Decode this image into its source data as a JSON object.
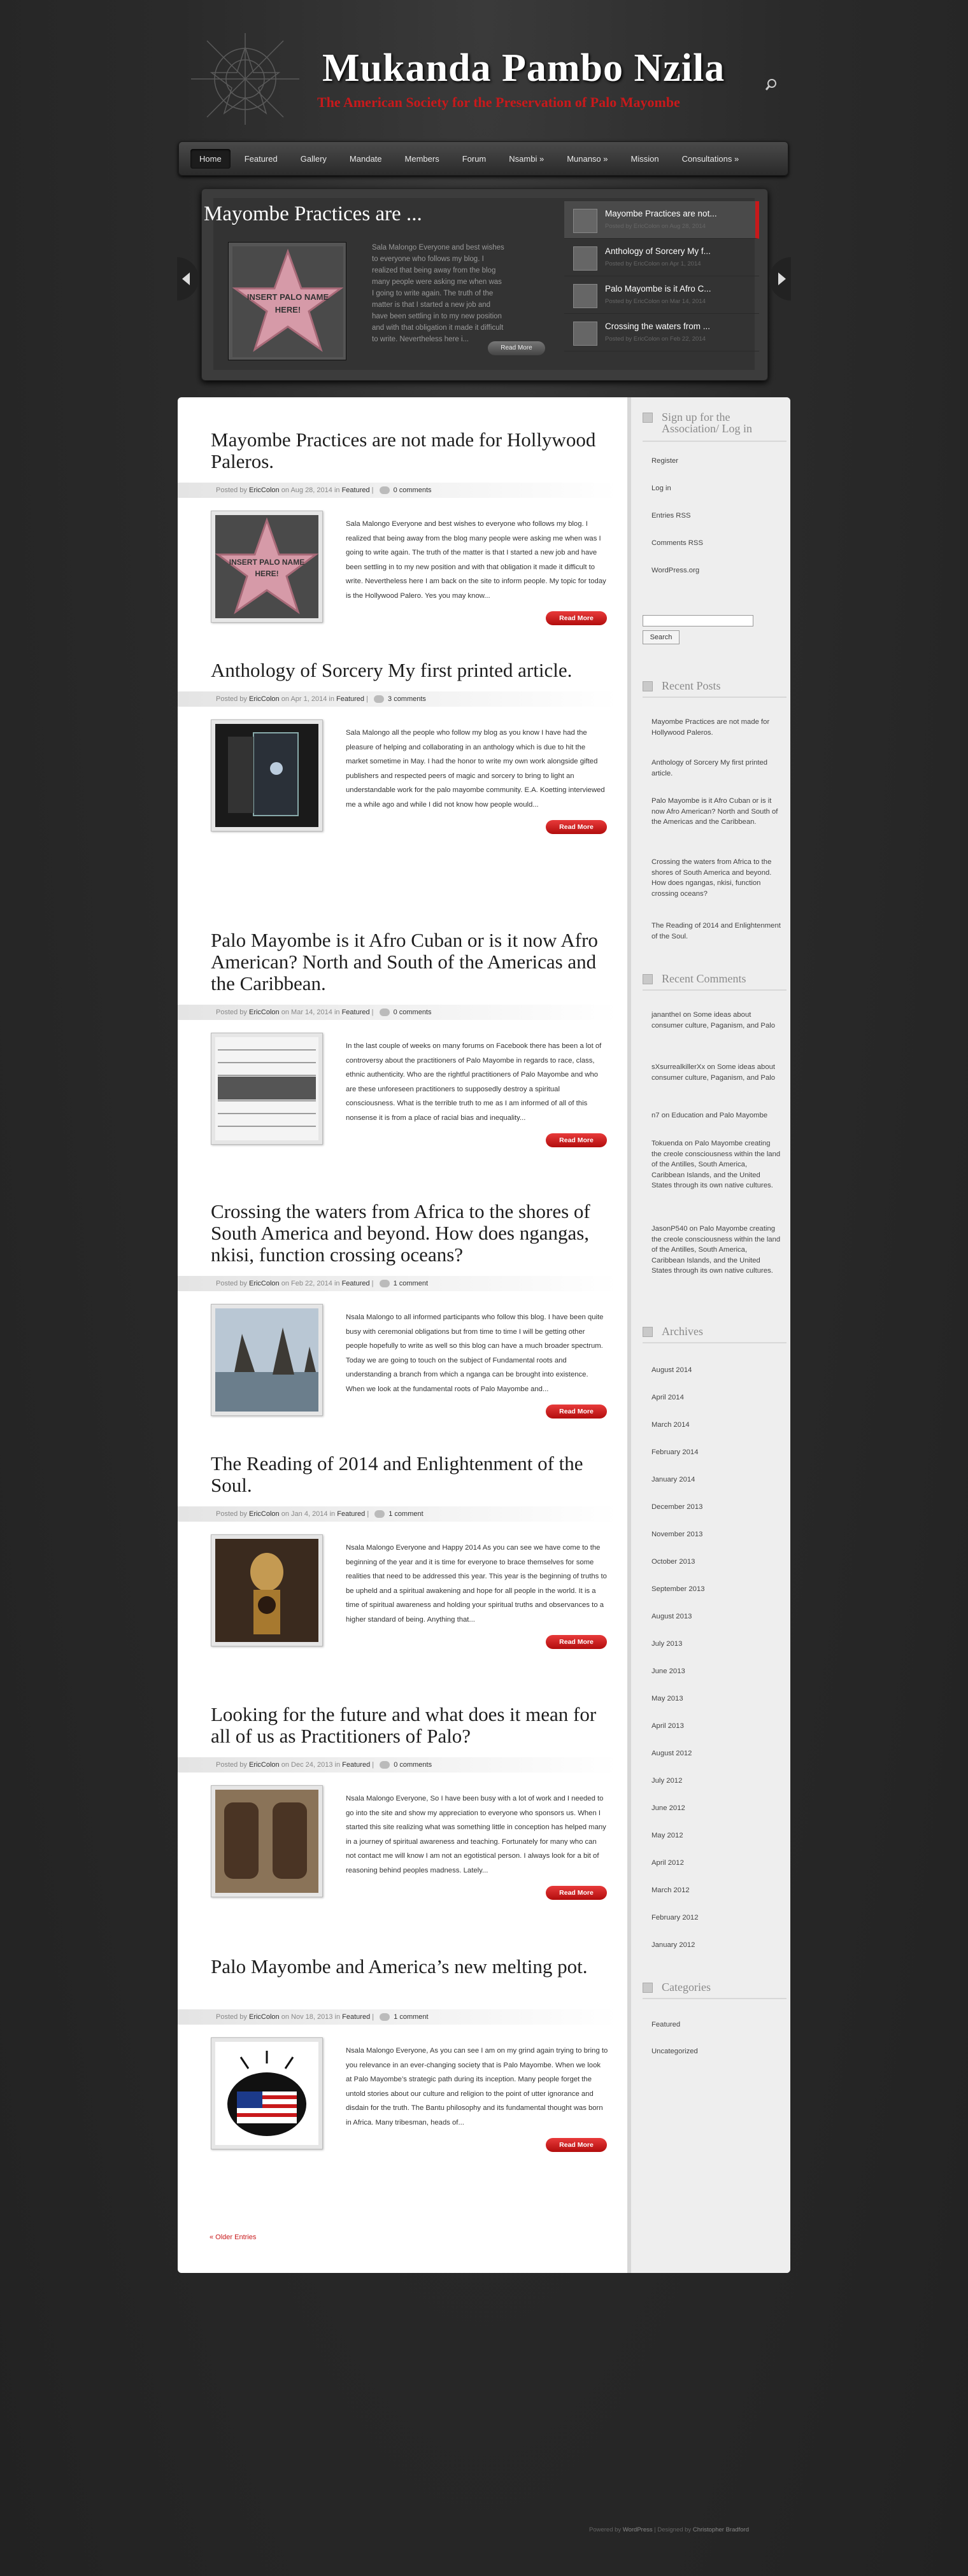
{
  "header": {
    "title": "Mukanda Pambo Nzila",
    "tagline": "The American Society for the Preservation of Palo Mayombe"
  },
  "nav": [
    "Home",
    "Featured",
    "Gallery",
    "Mandate",
    "Members",
    "Forum",
    "Nsambi »",
    "Munanso »",
    "Mission",
    "Consultations »"
  ],
  "slider": {
    "title": "Mayombe Practices are ...",
    "image_caption": "INSERT PALO NAME HERE!",
    "text": "Sala Malongo Everyone and best wishes to everyone who follows my blog. I realized that being away from the blog many people were asking me when was I going to write again. The truth of the matter is that I started a new job and have been settling in to my new position and with that obligation it made it difficult to write. Nevertheless here i...",
    "more": "Read More",
    "items": [
      {
        "title": "Mayombe Practices are not...",
        "meta": "Posted by EricColon on Aug 28, 2014"
      },
      {
        "title": "Anthology of Sorcery My f...",
        "meta": "Posted by EricColon on Apr 1, 2014"
      },
      {
        "title": "Palo Mayombe is it Afro C...",
        "meta": "Posted by EricColon on Mar 14, 2014"
      },
      {
        "title": "Crossing the waters from ...",
        "meta": "Posted by EricColon on Feb 22, 2014"
      }
    ]
  },
  "posts": [
    {
      "title": "Mayombe Practices are not made for Hollywood Paleros.",
      "author": "EricColon",
      "date": "Aug 28, 2014",
      "category": "Featured",
      "comments": "0 comments",
      "excerpt": "Sala Malongo Everyone and best wishes to everyone who follows my blog. I realized that being away from the blog many people were asking me when was I going to write again. The truth of the matter is that I started a new job and have been settling in to my new position and with that obligation it made it difficult to write. Nevertheless here I am back on the site to inform people. My topic for today is the Hollywood Palero. Yes you may know...",
      "more": "Read More"
    },
    {
      "title": "Anthology of Sorcery My first printed article.",
      "author": "EricColon",
      "date": "Apr 1, 2014",
      "category": "Featured",
      "comments": "3 comments",
      "excerpt": "Sala Malongo all the people who follow my blog as you know I have had the pleasure of helping and collaborating in an anthology which is due to hit the market sometime in May. I had the honor to write my own work alongside gifted publishers and respected peers of magic and sorcery to bring to light an understandable work for the palo mayombe community. E.A. Koetting interviewed me a while ago and while I did not know how people would...",
      "more": "Read More"
    },
    {
      "title": "Palo Mayombe is it Afro Cuban or is it now Afro American? North and South of the Americas and the Caribbean.",
      "author": "EricColon",
      "date": "Mar 14, 2014",
      "category": "Featured",
      "comments": "0 comments",
      "excerpt": "In the last couple of weeks on many forums on Facebook there has been a lot of controversy about the practitioners of Palo Mayombe in regards to race, class, ethnic authenticity. Who are the rightful practitioners of Palo Mayombe and who are these unforeseen practitioners to supposedly destroy a spiritual consciousness. What is the terrible truth to me as I am informed of all of this nonsense it is from a place of racial bias and inequality...",
      "more": "Read More"
    },
    {
      "title": "Crossing the waters from Africa to the shores of South America and beyond. How does ngangas, nkisi, function crossing oceans?",
      "author": "EricColon",
      "date": "Feb 22, 2014",
      "category": "Featured",
      "comments": "1 comment",
      "excerpt": "Nsala Malongo to all informed participants who follow this blog. I have been quite busy with ceremonial obligations but from time to time I will be getting other people hopefully to write as well so this blog can have a much broader spectrum. Today we are going to touch on the subject of Fundamental roots and understanding a branch from which a nganga can be brought into existence. When we look at the fundamental roots of Palo Mayombe and...",
      "more": "Read More"
    },
    {
      "title": "The Reading of 2014 and Enlightenment of the Soul.",
      "author": "EricColon",
      "date": "Jan 4, 2014",
      "category": "Featured",
      "comments": "1 comment",
      "excerpt": "Nsala Malongo Everyone and Happy 2014 As you can see we have come to the beginning of the year and it is time for everyone to brace themselves for some realities that need to be addressed this year. This year is the beginning of truths to be upheld and a spiritual awakening and hope for all people in the world. It is a time of spiritual awareness and holding your spiritual truths and observances to a higher standard of being. Anything that...",
      "more": "Read More"
    },
    {
      "title": "Looking for the future and what does it mean for all of us as Practitioners of Palo?",
      "author": "EricColon",
      "date": "Dec 24, 2013",
      "category": "Featured",
      "comments": "0 comments",
      "excerpt": "Nsala Malongo Everyone, So I have been busy with a lot of work and I needed to go into the site and show my appreciation to everyone who sponsors us. When I started this site realizing what was something little in conception has helped many in a journey of spiritual awareness and teaching. Fortunately for many who can not contact me will know I am not an egotistical person. I always look for a bit of reasoning behind peoples madness. Lately...",
      "more": "Read More"
    },
    {
      "title": "Palo Mayombe and America’s new melting pot.",
      "author": "EricColon",
      "date": "Nov 18, 2013",
      "category": "Featured",
      "comments": "1 comment",
      "excerpt": "Nsala Malongo Everyone, As you can see I am on my grind again trying to bring to you relevance in an ever-changing society that is Palo Mayombe. When we look at Palo Mayombe’s strategic path during its inception. Many people forget the untold stories about our culture and religion to the point of utter ignorance and disdain for the truth. The Bantu philosophy and its fundamental thought was born in Africa. Many tribesman, heads of...",
      "more": "Read More"
    }
  ],
  "labels": {
    "posted_by": "Posted by",
    "on": "on",
    "in": "in",
    "sep": "|"
  },
  "older_entries": "« Older Entries",
  "sidebar": {
    "signup": {
      "title": "Sign up for the Association/ Log in",
      "links": [
        "Register",
        "Log in",
        "Entries RSS",
        "Comments RSS",
        "WordPress.org"
      ],
      "search_button": "Search"
    },
    "recent_posts": {
      "title": "Recent Posts",
      "items": [
        "Mayombe Practices are not made for Hollywood Paleros.",
        "Anthology of Sorcery My first printed article.",
        "Palo Mayombe is it Afro Cuban or is it now Afro American? North and South of the Americas and the Caribbean.",
        "Crossing the waters from Africa to the shores of South America and beyond. How does ngangas, nkisi, function crossing oceans?",
        "The Reading of 2014 and Enlightenment of the Soul."
      ]
    },
    "recent_comments": {
      "title": "Recent Comments",
      "items": [
        "janantheI on Some ideas about consumer culture, Paganism, and Palo",
        "sXsurrealkillerXx on Some ideas about consumer culture, Paganism, and Palo",
        "n7 on Education and Palo Mayombe",
        "Tokuenda on Palo Mayombe creating the creole consciousness within the land of the Antilles, South America, Caribbean Islands, and the United States through its own native cultures.",
        "JasonP540 on Palo Mayombe creating the creole consciousness within the land of the Antilles, South America, Caribbean Islands, and the United States through its own native cultures."
      ]
    },
    "archives": {
      "title": "Archives",
      "items": [
        "August 2014",
        "April 2014",
        "March 2014",
        "February 2014",
        "January 2014",
        "December 2013",
        "November 2013",
        "October 2013",
        "September 2013",
        "August 2013",
        "July 2013",
        "June 2013",
        "May 2013",
        "April 2013",
        "August 2012",
        "July 2012",
        "June 2012",
        "May 2012",
        "April 2012",
        "March 2012",
        "February 2012",
        "January 2012"
      ]
    },
    "categories": {
      "title": "Categories",
      "items": [
        "Featured",
        "Uncategorized"
      ]
    }
  },
  "footer": {
    "powered": "Powered by",
    "wp": "WordPress",
    "designed": "| Designed by",
    "designer": "Christopher Bradford"
  },
  "colors": {
    "accent": "#c8191b",
    "background": "#2b2b2b"
  }
}
